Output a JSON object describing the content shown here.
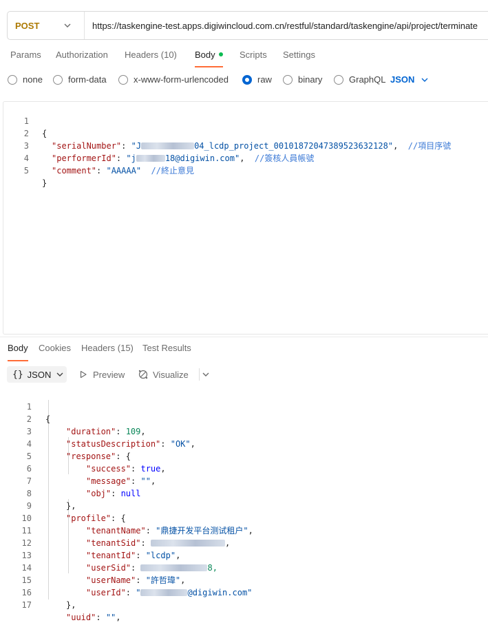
{
  "request": {
    "method": "POST",
    "url": "https://taskengine-test.apps.digiwincloud.com.cn/restful/standard/taskengine/api/project/terminate"
  },
  "request_tabs": [
    {
      "label": "Params",
      "count": ""
    },
    {
      "label": "Authorization",
      "count": ""
    },
    {
      "label": "Headers",
      "count": "(10)"
    },
    {
      "label": "Body",
      "count": ""
    },
    {
      "label": "Scripts",
      "count": ""
    },
    {
      "label": "Settings",
      "count": ""
    }
  ],
  "body_types": [
    "none",
    "form-data",
    "x-www-form-urlencoded",
    "raw",
    "binary",
    "GraphQL"
  ],
  "body_type_selected": "raw",
  "raw_format": "JSON",
  "request_body": {
    "line_numbers": [
      "1",
      "2",
      "3",
      "4",
      "5"
    ],
    "open_brace": "{",
    "close_brace": "}",
    "serial_key": "\"serialNumber\"",
    "serial_value_prefix": "\"J",
    "serial_value_suffix": "04_lcdp_project_0010187204738952363212 8\"",
    "serial_comment": "//項目序號",
    "performer_key": "\"performerId\"",
    "performer_value_prefix": "\"j",
    "performer_value_suffix": "18@digiwin.com\"",
    "performer_comment": "//簽核人員帳號",
    "comment_key": "\"comment\"",
    "comment_value": "\"AAAAA\"",
    "comment_comment": "//終止意見"
  },
  "response_tabs": [
    {
      "label": "Body",
      "count": ""
    },
    {
      "label": "Cookies",
      "count": ""
    },
    {
      "label": "Headers",
      "count": "(15)"
    },
    {
      "label": "Test Results",
      "count": ""
    }
  ],
  "response_toolbar": {
    "format_label": "JSON",
    "preview_label": "Preview",
    "visualize_label": "Visualize"
  },
  "response_body": {
    "line_numbers": [
      "1",
      "2",
      "3",
      "4",
      "5",
      "6",
      "7",
      "8",
      "9",
      "10",
      "11",
      "12",
      "13",
      "14",
      "15",
      "16",
      "17"
    ],
    "l1": "{",
    "duration_key": "\"duration\"",
    "duration_value": "109",
    "status_key": "\"statusDescription\"",
    "status_value": "\"OK\"",
    "response_key": "\"response\"",
    "success_key": "\"success\"",
    "success_value": "true",
    "message_key": "\"message\"",
    "message_value": "\"\"",
    "obj_key": "\"obj\"",
    "obj_value": "null",
    "close_obj": "},",
    "profile_key": "\"profile\"",
    "tenantName_key": "\"tenantName\"",
    "tenantName_value": "\"鼎捷开发平台测试租户\"",
    "tenantSid_key": "\"tenantSid\"",
    "tenantId_key": "\"tenantId\"",
    "tenantId_value": "\"lcdp\"",
    "userSid_key": "\"userSid\"",
    "userSid_suffix": "8,",
    "userName_key": "\"userName\"",
    "userName_value": "\"許哲瑋\"",
    "userId_key": "\"userId\"",
    "userId_prefix": "\"",
    "userId_suffix": "@digiwin.com\"",
    "uuid_key": "\"uuid\"",
    "uuid_value": "\"\""
  },
  "colors": {
    "accent": "#ff6c37",
    "method": "#ad7a03",
    "selected": "#0265d2",
    "dot": "#0cbb52"
  }
}
